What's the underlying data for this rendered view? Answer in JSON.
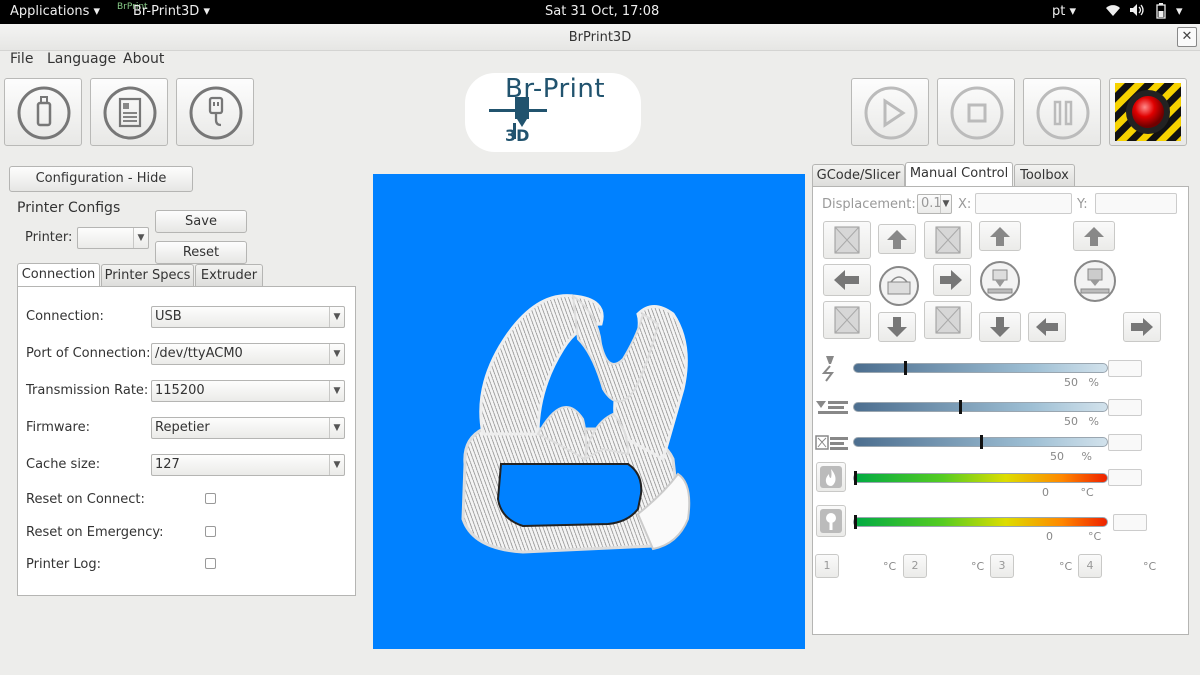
{
  "topbar": {
    "applications": "Applications",
    "app_name": "Br-Print3D",
    "app_icon_text": "BrPrint",
    "clock": "Sat 31 Oct, 17:08",
    "lang": "pt"
  },
  "window": {
    "title": "BrPrint3D"
  },
  "menu": {
    "file": "File",
    "language": "Language",
    "about": "About"
  },
  "logo": {
    "text": "Br-Print",
    "sub": "3D"
  },
  "left": {
    "config_toggle": "Configuration - Hide",
    "printer_configs": "Printer  Configs",
    "printer_label": "Printer:",
    "printer_value": "",
    "save": "Save",
    "reset": "Reset",
    "tabs": [
      "Connection",
      "Printer Specs",
      "Extruder"
    ],
    "connection_label": "Connection:",
    "connection_value": "USB",
    "port_label": "Port of Connection:",
    "port_value": "/dev/ttyACM0",
    "rate_label": "Transmission Rate:",
    "rate_value": "115200",
    "firmware_label": "Firmware:",
    "firmware_value": "Repetier",
    "cache_label": "Cache size:",
    "cache_value": "127",
    "reset_connect": "Reset on Connect:",
    "reset_emergency": "Reset on Emergency:",
    "printer_log": "Printer Log:"
  },
  "right": {
    "tabs": [
      "GCode/Slicer",
      "Manual Control",
      "Toolbox"
    ],
    "displacement_label": "Displacement:",
    "displacement_value": "0.1",
    "x_label": "X:",
    "y_label": "Y:",
    "sliders": [
      {
        "value": "50",
        "unit": "%",
        "level": 0.2
      },
      {
        "value": "50",
        "unit": "%",
        "level": 0.42
      },
      {
        "value": "50",
        "unit": "%",
        "level": 0.5
      },
      {
        "value": "0",
        "unit": "°C",
        "level": 0.0
      },
      {
        "value": "0",
        "unit": "°C",
        "level": 0.0
      }
    ],
    "extruders": [
      "1",
      "2",
      "3",
      "4"
    ],
    "temp_unit": "°C"
  },
  "colors": {
    "viewport_bg": "#0081ff",
    "logo_text": "#21536e"
  }
}
